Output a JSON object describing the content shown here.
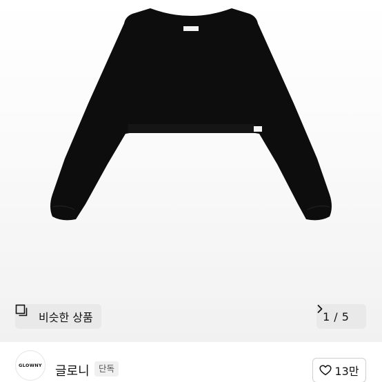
{
  "product": {
    "image_description_icon": "product-photo",
    "garment_color": "#0d0d0d"
  },
  "similar_products": {
    "label": "비슷한 상품",
    "icon": "similar-products-icon"
  },
  "pager": {
    "current": "1",
    "separator": "/",
    "total": "5",
    "icon": "chevron-right-icon"
  },
  "seller": {
    "logo_text": "GLOWNY",
    "name": "글로니",
    "badge": "단독"
  },
  "like": {
    "count": "13만",
    "icon": "heart-icon"
  }
}
